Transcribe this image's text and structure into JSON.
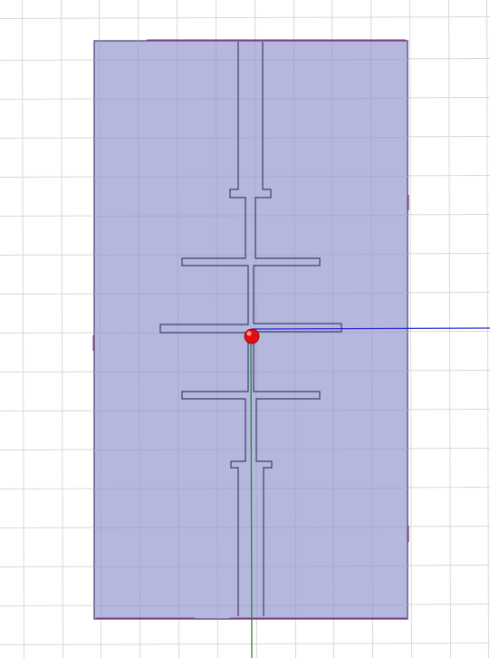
{
  "viewport": {
    "background": "#ffffff",
    "grid_color": "#d9d9d9",
    "substrate_fill": "#b6b7dc",
    "substrate_grid_color": "#a9aad1",
    "outline_color": "#3b3f73",
    "edge_highlight": "#7a3d7d",
    "x_axis_color": "#2b2bd6",
    "y_axis_color": "#1f8a3a",
    "origin_marker_color": "#e01010"
  }
}
